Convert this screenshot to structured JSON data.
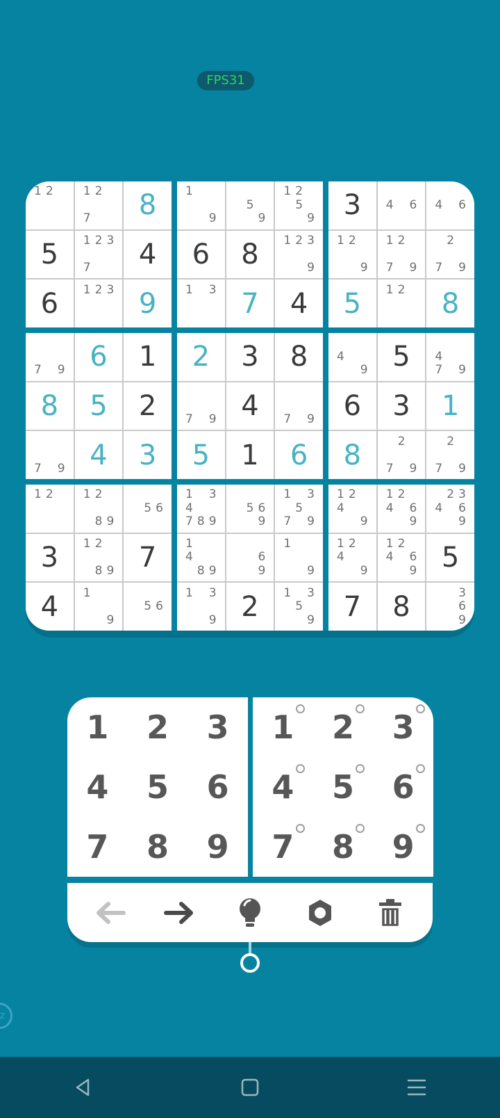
{
  "status": {
    "fps_label": "FPS31"
  },
  "board": {
    "boxes": [
      [
        {
          "notes": [
            "1",
            "2",
            "",
            "",
            "",
            "",
            "",
            "",
            ""
          ]
        },
        {
          "notes": [
            "1",
            "2",
            "",
            "",
            "",
            "",
            "7",
            "",
            ""
          ]
        },
        {
          "value": "8",
          "kind": "user"
        },
        {
          "value": "5",
          "kind": "given"
        },
        {
          "notes": [
            "1",
            "2",
            "3",
            "",
            "",
            "",
            "7",
            "",
            ""
          ]
        },
        {
          "value": "4",
          "kind": "given"
        },
        {
          "value": "6",
          "kind": "given"
        },
        {
          "notes": [
            "1",
            "2",
            "3",
            "",
            "",
            "",
            "",
            "",
            ""
          ]
        },
        {
          "value": "9",
          "kind": "user"
        }
      ],
      [
        {
          "notes": [
            "1",
            "",
            "",
            "",
            "",
            "",
            "",
            "",
            "9"
          ]
        },
        {
          "notes": [
            "",
            "",
            "",
            "",
            "5",
            "",
            "",
            "",
            "9"
          ]
        },
        {
          "notes": [
            "1",
            "2",
            "",
            "",
            "5",
            "",
            "",
            "",
            "9"
          ]
        },
        {
          "value": "6",
          "kind": "given"
        },
        {
          "value": "8",
          "kind": "given"
        },
        {
          "notes": [
            "1",
            "2",
            "3",
            "",
            "",
            "",
            "",
            "",
            "9"
          ]
        },
        {
          "notes": [
            "1",
            "",
            "3",
            "",
            "",
            "",
            "",
            "",
            ""
          ]
        },
        {
          "value": "7",
          "kind": "user"
        },
        {
          "value": "4",
          "kind": "given"
        }
      ],
      [
        {
          "value": "3",
          "kind": "given"
        },
        {
          "notes": [
            "",
            "",
            "",
            "4",
            "",
            "6",
            "",
            "",
            ""
          ]
        },
        {
          "notes": [
            "",
            "",
            "",
            "4",
            "",
            "6",
            "",
            "",
            ""
          ]
        },
        {
          "notes": [
            "1",
            "2",
            "",
            "",
            "",
            "",
            "",
            "",
            "9"
          ]
        },
        {
          "notes": [
            "1",
            "2",
            "",
            "",
            "",
            "",
            "7",
            "",
            "9"
          ]
        },
        {
          "notes": [
            "",
            "2",
            "",
            "",
            "",
            "",
            "7",
            "",
            "9"
          ]
        },
        {
          "value": "5",
          "kind": "user"
        },
        {
          "notes": [
            "1",
            "2",
            "",
            "",
            "",
            "",
            "",
            "",
            ""
          ]
        },
        {
          "value": "8",
          "kind": "user"
        }
      ],
      [
        {
          "notes": [
            "",
            "",
            "",
            "",
            "",
            "",
            "7",
            "",
            "9"
          ]
        },
        {
          "value": "6",
          "kind": "user"
        },
        {
          "value": "1",
          "kind": "given"
        },
        {
          "value": "8",
          "kind": "user"
        },
        {
          "value": "5",
          "kind": "user"
        },
        {
          "value": "2",
          "kind": "given"
        },
        {
          "notes": [
            "",
            "",
            "",
            "",
            "",
            "",
            "7",
            "",
            "9"
          ]
        },
        {
          "value": "4",
          "kind": "user"
        },
        {
          "value": "3",
          "kind": "user"
        }
      ],
      [
        {
          "value": "2",
          "kind": "user"
        },
        {
          "value": "3",
          "kind": "given"
        },
        {
          "value": "8",
          "kind": "given"
        },
        {
          "notes": [
            "",
            "",
            "",
            "",
            "",
            "",
            "7",
            "",
            "9"
          ]
        },
        {
          "value": "4",
          "kind": "given"
        },
        {
          "notes": [
            "",
            "",
            "",
            "",
            "",
            "",
            "7",
            "",
            "9"
          ]
        },
        {
          "value": "5",
          "kind": "user"
        },
        {
          "value": "1",
          "kind": "given"
        },
        {
          "value": "6",
          "kind": "user"
        }
      ],
      [
        {
          "notes": [
            "",
            "",
            "",
            "4",
            "",
            "",
            "",
            "",
            "9"
          ]
        },
        {
          "value": "5",
          "kind": "given"
        },
        {
          "notes": [
            "",
            "",
            "",
            "4",
            "",
            "",
            "7",
            "",
            "9"
          ]
        },
        {
          "value": "6",
          "kind": "given"
        },
        {
          "value": "3",
          "kind": "given"
        },
        {
          "value": "1",
          "kind": "user"
        },
        {
          "value": "8",
          "kind": "user"
        },
        {
          "notes": [
            "",
            "2",
            "",
            "",
            "",
            "",
            "7",
            "",
            "9"
          ]
        },
        {
          "notes": [
            "",
            "2",
            "",
            "",
            "",
            "",
            "7",
            "",
            "9"
          ]
        }
      ],
      [
        {
          "notes": [
            "1",
            "2",
            "",
            "",
            "",
            "",
            "",
            "",
            ""
          ]
        },
        {
          "notes": [
            "1",
            "2",
            "",
            "",
            "",
            "",
            "",
            "8",
            "9"
          ]
        },
        {
          "notes": [
            "",
            "",
            "",
            "",
            "5",
            "6",
            "",
            "",
            ""
          ]
        },
        {
          "value": "3",
          "kind": "given"
        },
        {
          "notes": [
            "1",
            "2",
            "",
            "",
            "",
            "",
            "",
            "8",
            "9"
          ]
        },
        {
          "value": "7",
          "kind": "given"
        },
        {
          "value": "4",
          "kind": "given"
        },
        {
          "notes": [
            "1",
            "",
            "",
            "",
            "",
            "",
            "",
            "",
            "9"
          ]
        },
        {
          "notes": [
            "",
            "",
            "",
            "",
            "5",
            "6",
            "",
            "",
            ""
          ]
        }
      ],
      [
        {
          "notes": [
            "1",
            "",
            "3",
            "4",
            "",
            "",
            "7",
            "8",
            "9"
          ]
        },
        {
          "notes": [
            "",
            "",
            "",
            "",
            "5",
            "6",
            "",
            "",
            "9"
          ]
        },
        {
          "notes": [
            "1",
            "",
            "3",
            "",
            "5",
            "",
            "7",
            "",
            "9"
          ]
        },
        {
          "notes": [
            "1",
            "",
            "",
            "4",
            "",
            "",
            "",
            "8",
            "9"
          ]
        },
        {
          "notes": [
            "",
            "",
            "",
            "",
            "",
            "6",
            "",
            "",
            "9"
          ]
        },
        {
          "notes": [
            "1",
            "",
            "",
            "",
            "",
            "",
            "",
            "",
            "9"
          ]
        },
        {
          "notes": [
            "1",
            "",
            "3",
            "",
            "",
            "",
            "",
            "",
            "9"
          ]
        },
        {
          "value": "2",
          "kind": "given"
        },
        {
          "notes": [
            "1",
            "",
            "3",
            "",
            "5",
            "",
            "",
            "",
            "9"
          ]
        }
      ],
      [
        {
          "notes": [
            "1",
            "2",
            "",
            "4",
            "",
            "",
            "",
            "",
            "9"
          ]
        },
        {
          "notes": [
            "1",
            "2",
            "",
            "4",
            "",
            "6",
            "",
            "",
            "9"
          ]
        },
        {
          "notes": [
            "",
            "2",
            "3",
            "4",
            "",
            "6",
            "",
            "",
            "9"
          ]
        },
        {
          "notes": [
            "1",
            "2",
            "",
            "4",
            "",
            "",
            "",
            "",
            "9"
          ]
        },
        {
          "notes": [
            "1",
            "2",
            "",
            "4",
            "",
            "6",
            "",
            "",
            "9"
          ]
        },
        {
          "value": "5",
          "kind": "given"
        },
        {
          "value": "7",
          "kind": "given"
        },
        {
          "value": "8",
          "kind": "given"
        },
        {
          "notes": [
            "",
            "",
            "3",
            "",
            "",
            "6",
            "",
            "",
            "9"
          ]
        }
      ]
    ]
  },
  "keypad": {
    "value_keys": [
      "1",
      "2",
      "3",
      "4",
      "5",
      "6",
      "7",
      "8",
      "9"
    ],
    "note_keys": [
      "1",
      "2",
      "3",
      "4",
      "5",
      "6",
      "7",
      "8",
      "9"
    ]
  },
  "toolbar": {
    "icons": [
      "undo-arrow-icon",
      "redo-arrow-icon",
      "hint-bulb-icon",
      "settings-gear-icon",
      "trash-icon"
    ]
  },
  "sleep_badge": {
    "label": "zz"
  },
  "colors": {
    "background": "#0683a1",
    "given_digit": "#3a3a3a",
    "user_digit": "#47b3c1",
    "note_digit": "#707070",
    "fps_text": "#2fd06a",
    "nav_bar": "#064b5f"
  }
}
